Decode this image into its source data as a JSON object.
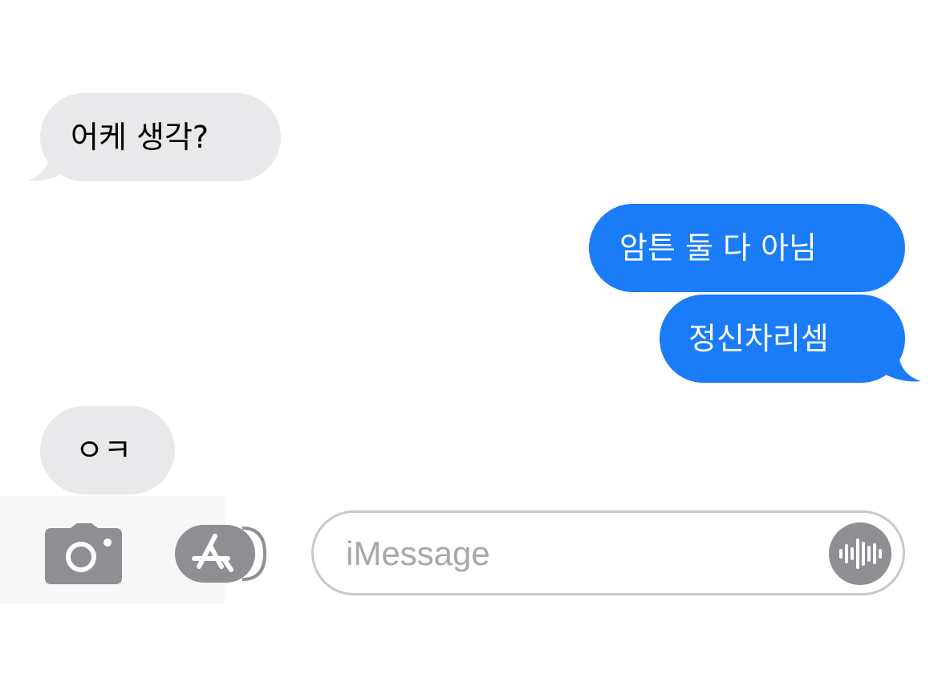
{
  "conversation": {
    "messages": [
      {
        "direction": "incoming",
        "text": "어케 생각?"
      },
      {
        "direction": "outgoing",
        "text": "암튼 둘 다 아님"
      },
      {
        "direction": "outgoing",
        "text": "정신차리셈"
      },
      {
        "direction": "incoming",
        "text": "ㅇㅋ"
      }
    ]
  },
  "input_bar": {
    "placeholder": "iMessage",
    "value": "",
    "camera_icon": "camera-icon",
    "apps_icon": "app-store-icon",
    "audio_icon": "waveform-icon"
  },
  "colors": {
    "incoming_bubble": "#e9e9eb",
    "outgoing_bubble": "#1a7cf6",
    "icon_gray": "#8e8e93"
  }
}
